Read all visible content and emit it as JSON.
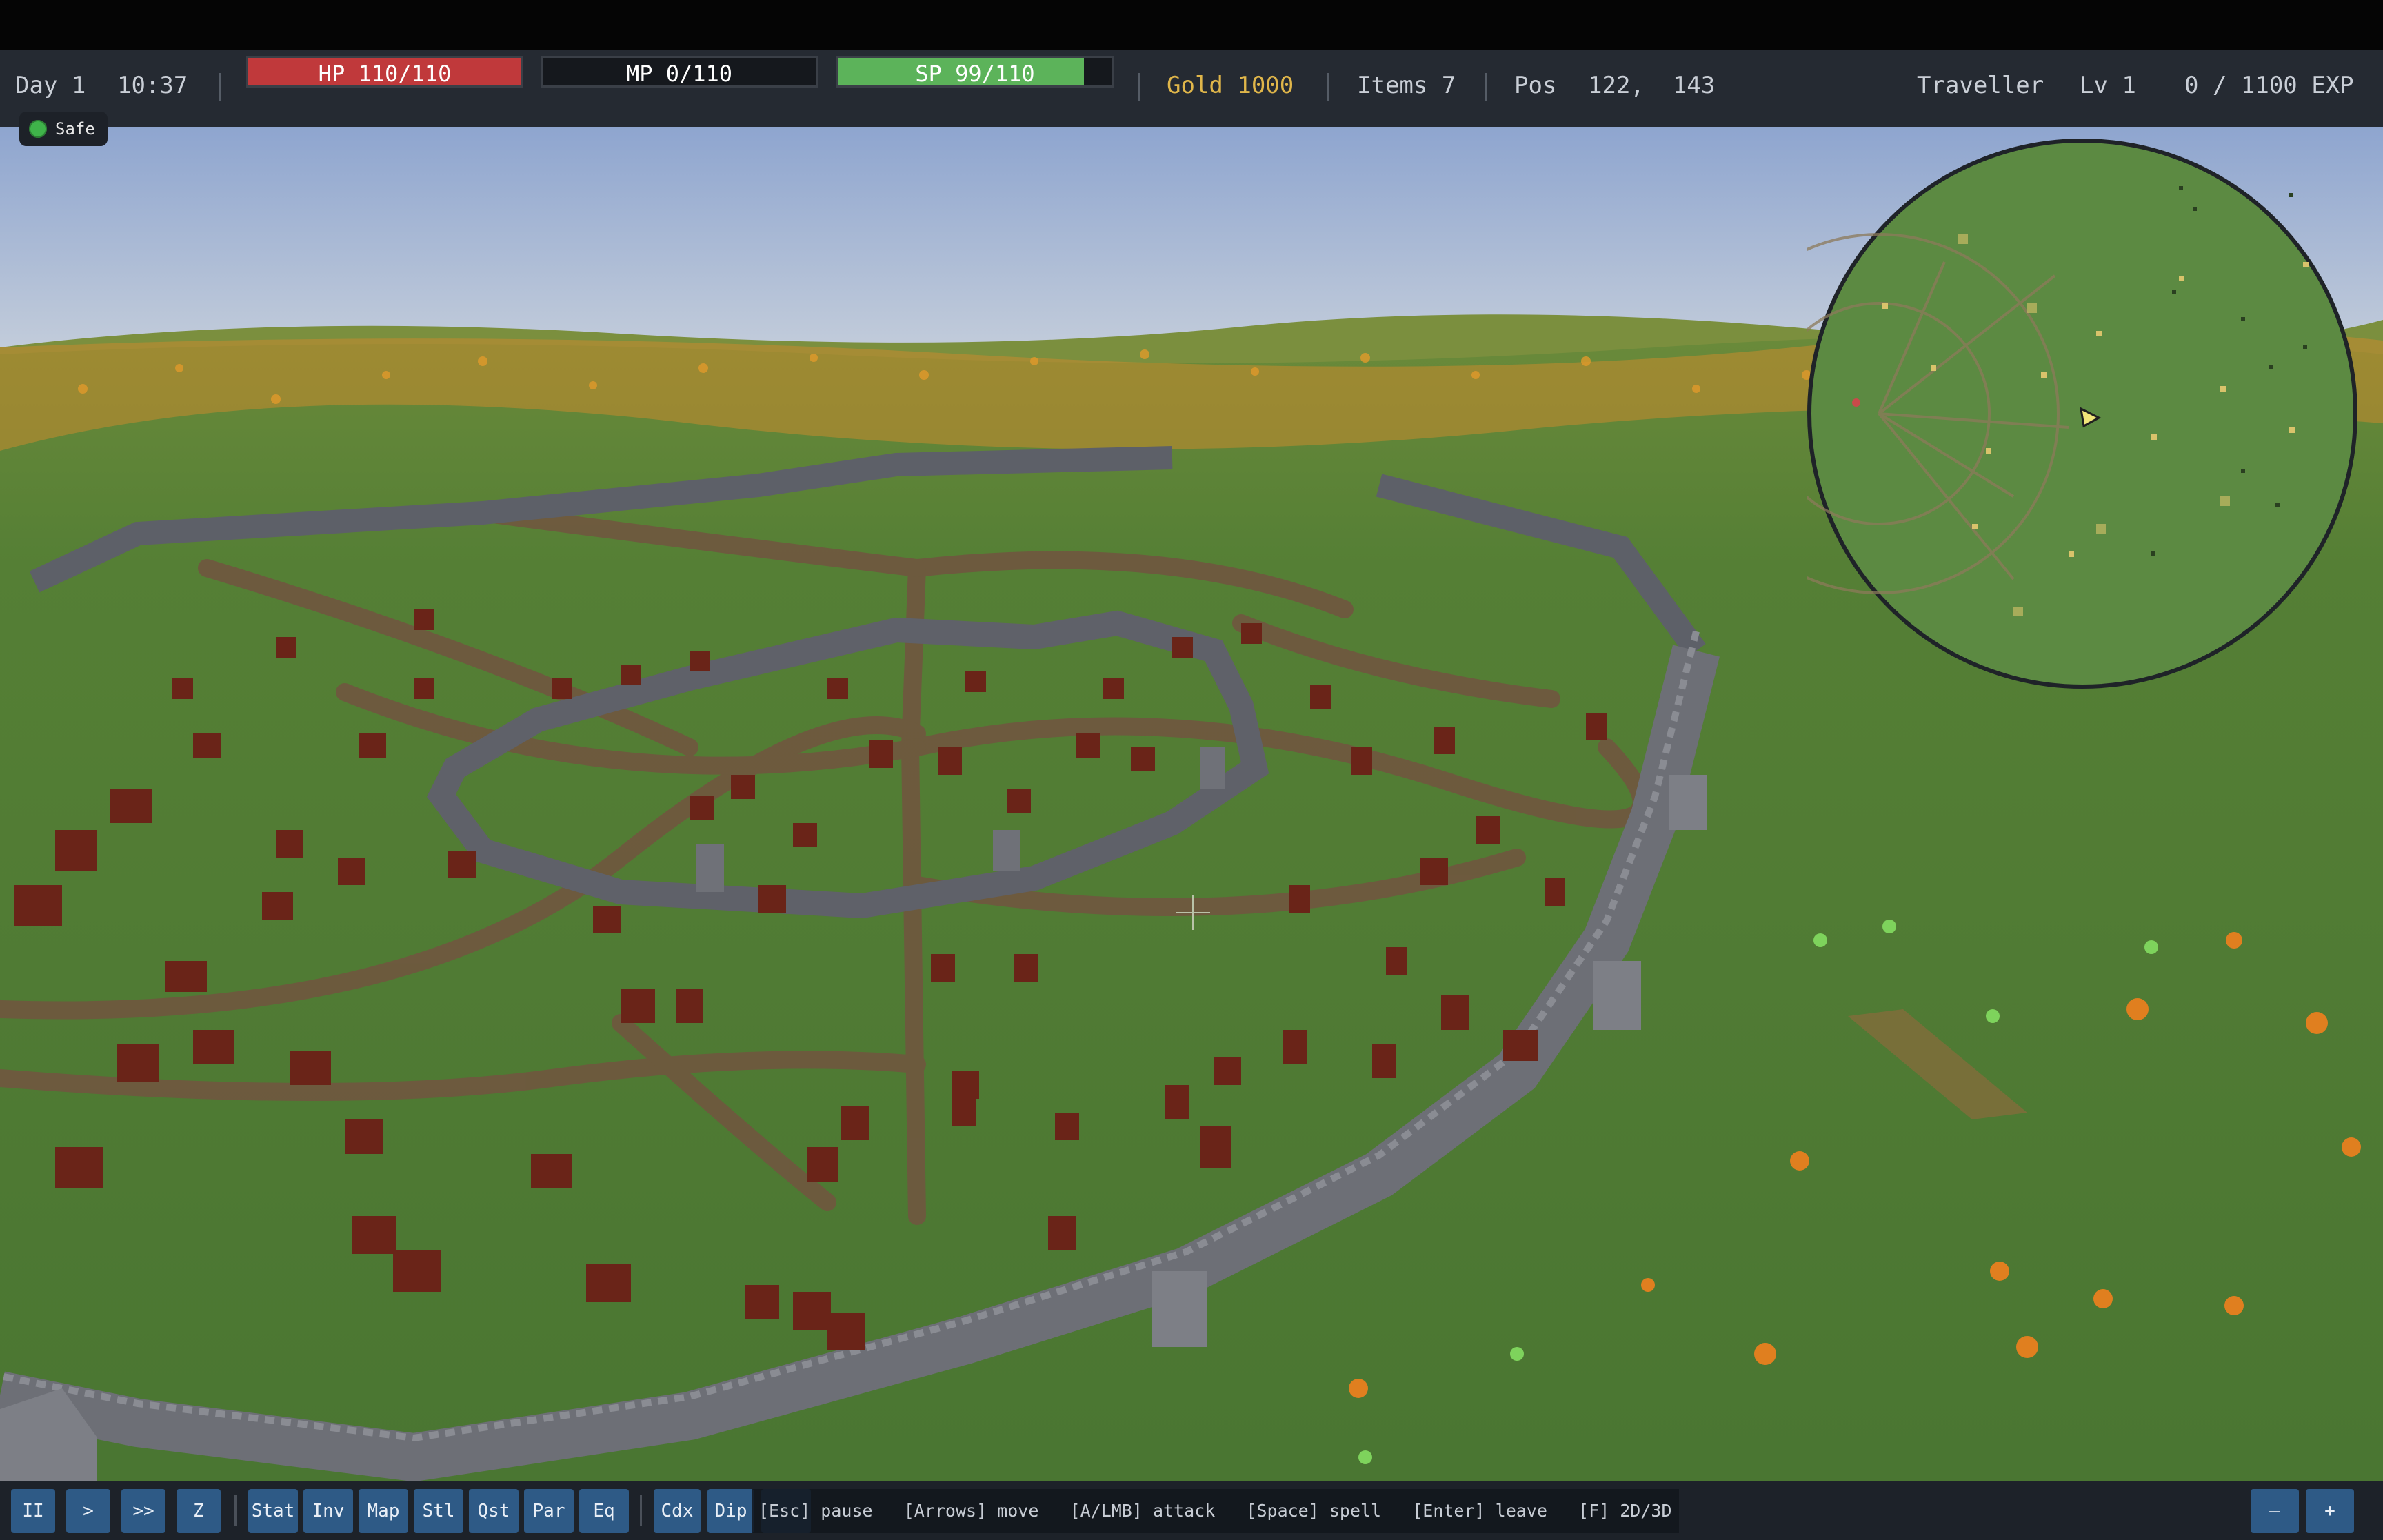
{
  "hud": {
    "day": "Day 1",
    "time": "10:37",
    "hp": {
      "label": "HP 110/110",
      "current": 110,
      "max": 110,
      "color": "#c0393b"
    },
    "mp": {
      "label": "MP 0/110",
      "current": 0,
      "max": 110,
      "color": "#2f6fd6"
    },
    "sp": {
      "label": "SP 99/110",
      "current": 99,
      "max": 110,
      "color": "#5cb35a"
    },
    "gold": "Gold 1000",
    "items": "Items 7",
    "pos_label": "Pos",
    "pos": "122,  143",
    "class": "Traveller",
    "level": "Lv 1",
    "exp": "0 / 1100 EXP"
  },
  "status": {
    "label": "Safe",
    "color": "#3fb34a"
  },
  "controls": {
    "speed": [
      "II",
      ">",
      ">>",
      "Z"
    ],
    "panels": [
      "Stat",
      "Inv",
      "Map",
      "Stl",
      "Qst",
      "Par",
      "Eq"
    ],
    "extra": [
      "Cdx",
      "Dip"
    ],
    "hints": "[Esc] pause   [Arrows] move   [A/LMB] attack   [Space] spell   [Enter] leave   [F] 2D/3D",
    "zoom_out": "–",
    "zoom_in": "+"
  },
  "colors": {
    "sky_top": "#8fa6cf",
    "sky_horizon": "#c4cdd9",
    "grass": "#4e7a34",
    "path": "#6e5640",
    "wall": "#6f7178",
    "house": "#6a2418",
    "minimap_bg": "#5c8a42"
  }
}
